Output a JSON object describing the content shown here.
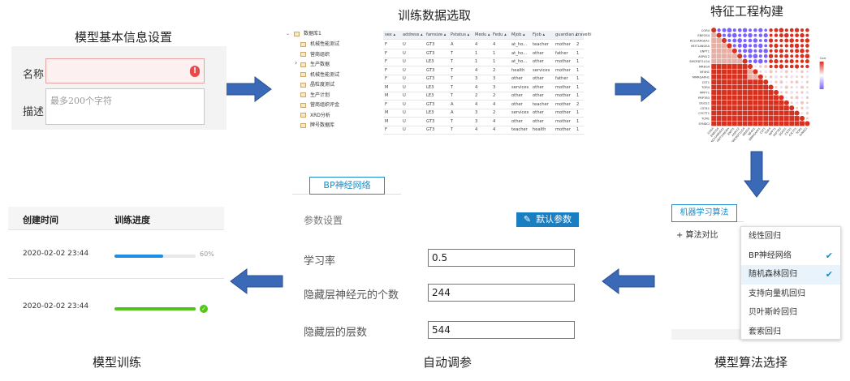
{
  "titles": {
    "basic_info": "模型基本信息设置",
    "data_select": "训练数据选取",
    "feature": "特征工程构建",
    "algorithm": "模型算法选择",
    "auto_tune": "自动调参",
    "training": "模型训练"
  },
  "basic_form": {
    "name_label": "名称",
    "desc_label": "描述",
    "desc_placeholder": "最多200个字符",
    "error_icon": "!"
  },
  "tree": {
    "root": "数据库1",
    "items": [
      "机械性能测试",
      "营商组织",
      "生产数据",
      "机械性能测试",
      "晶粒度测试",
      "生产计划",
      "营商组织评金",
      "XRD分析",
      "牌号数据库"
    ]
  },
  "data_table": {
    "headers": [
      "sex ▴",
      "address ▴",
      "famsize ▴",
      "Pstatus ▴",
      "Medu ▴",
      "Fedu ▴",
      "Mjob ▴",
      "Fjob ▴",
      "guardian ▴",
      "travelti"
    ],
    "rows": [
      [
        "F",
        "U",
        "GT3",
        "A",
        "4",
        "4",
        "at_ho...",
        "teacher",
        "mother",
        "2"
      ],
      [
        "F",
        "U",
        "GT3",
        "T",
        "1",
        "1",
        "at_ho...",
        "other",
        "father",
        "1"
      ],
      [
        "F",
        "U",
        "LE3",
        "T",
        "1",
        "1",
        "at_ho...",
        "other",
        "mother",
        "1"
      ],
      [
        "F",
        "U",
        "GT3",
        "T",
        "4",
        "2",
        "health",
        "services",
        "mother",
        "1"
      ],
      [
        "F",
        "U",
        "GT3",
        "T",
        "3",
        "3",
        "other",
        "other",
        "father",
        "1"
      ],
      [
        "M",
        "U",
        "LE3",
        "T",
        "4",
        "3",
        "services",
        "other",
        "mother",
        "1"
      ],
      [
        "M",
        "U",
        "LE3",
        "T",
        "2",
        "2",
        "other",
        "other",
        "mother",
        "1"
      ],
      [
        "F",
        "U",
        "GT3",
        "A",
        "4",
        "4",
        "other",
        "teacher",
        "mother",
        "2"
      ],
      [
        "M",
        "U",
        "LE3",
        "A",
        "3",
        "2",
        "services",
        "other",
        "mother",
        "1"
      ],
      [
        "M",
        "U",
        "GT3",
        "T",
        "3",
        "4",
        "other",
        "other",
        "mother",
        "1"
      ],
      [
        "F",
        "U",
        "GT3",
        "T",
        "4",
        "4",
        "teacher",
        "health",
        "mother",
        "1"
      ]
    ]
  },
  "heatmap": {
    "row_labels": [
      "COR4",
      "ENEOS4",
      "KCS1ANGEA1",
      "HEIT1ANGEA",
      "ENPT1",
      "ASPA12",
      "SMCRDT1LG4",
      "MREG4",
      "NF4H1",
      "MMRGAPH1",
      "CST1",
      "TGR4",
      "MPP71",
      "PRP7B3",
      "DGCE1",
      "CST41",
      "CYCTT1",
      "TCM1",
      "SYNDCI"
    ],
    "legend_title": "Corr",
    "colors": {
      "positive": "#d7301f",
      "negative": "#7b61ff"
    }
  },
  "auto_tune": {
    "tab_label": "BP神经网络",
    "section_label": "参数设置",
    "default_button": "默认参数",
    "params": [
      {
        "label": "学习率",
        "value": "0.5"
      },
      {
        "label": "隐藏层神经元的个数",
        "value": "244"
      },
      {
        "label": "隐藏层的层数",
        "value": "544"
      }
    ]
  },
  "algorithm": {
    "tab_label": "机器学习算法",
    "compare_label": "+ 算法对比",
    "options": [
      {
        "label": "线性回归",
        "checked": false,
        "highlighted": false
      },
      {
        "label": "BP神经网络",
        "checked": true,
        "highlighted": false
      },
      {
        "label": "随机森林回归",
        "checked": true,
        "highlighted": true
      },
      {
        "label": "支持向量机回归",
        "checked": false,
        "highlighted": false
      },
      {
        "label": "贝叶斯岭回归",
        "checked": false,
        "highlighted": false
      },
      {
        "label": "套索回归",
        "checked": false,
        "highlighted": false
      }
    ]
  },
  "training": {
    "col_time": "创建时间",
    "col_progress": "训练进度",
    "rows": [
      {
        "time": "2020-02-02 23:44",
        "progress": 0.6,
        "progress_text": "60%",
        "color": "#1e8fe0"
      },
      {
        "time": "2020-02-02 23:44",
        "progress": 1.0,
        "progress_text": "",
        "color": "#52c41a"
      }
    ]
  },
  "colors": {
    "arrow": "#3a69b8",
    "accent": "#1a8ccc"
  }
}
